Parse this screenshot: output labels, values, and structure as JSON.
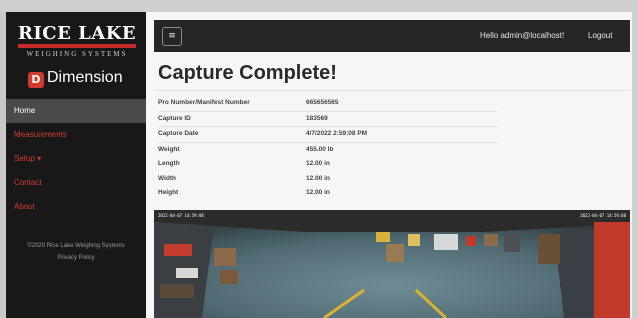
{
  "brand": {
    "name": "RICE LAKE",
    "subtitle": "WEIGHING SYSTEMS",
    "product_icon": "D",
    "product": "Dimension"
  },
  "nav": [
    {
      "label": "Home",
      "active": true
    },
    {
      "label": "Measurements"
    },
    {
      "label": "Setup ▾"
    },
    {
      "label": "Contact"
    },
    {
      "label": "About"
    }
  ],
  "footer": {
    "copyright": "©2020 Rice Lake Weighing Systems",
    "privacy": "Privacy Policy"
  },
  "topbar": {
    "menu_icon": "menu-icon",
    "menu_glyph": "≡",
    "user": "Hello admin@localhost!",
    "logout": "Logout"
  },
  "page": {
    "title": "Capture Complete!"
  },
  "details": [
    {
      "label": "Pro Number/Manifest Number",
      "value": "665656565"
    },
    {
      "label": "Capture ID",
      "value": "183569"
    },
    {
      "label": "Capture Date",
      "value": "4/7/2022 2:59:08 PM"
    },
    {
      "label": "Weight",
      "value": "455.00 lb"
    },
    {
      "label": "Length",
      "value": "12.00 in"
    },
    {
      "label": "Width",
      "value": "12.00 in"
    },
    {
      "label": "Height",
      "value": "12.00 in"
    }
  ],
  "camera": {
    "stamp_left": "2022-04-07 14:59:08",
    "stamp_right": "2022-04-07 14:59:08"
  },
  "colors": {
    "accent_red": "#d23a2f",
    "sidebar": "#181818",
    "topbar": "#262626"
  }
}
